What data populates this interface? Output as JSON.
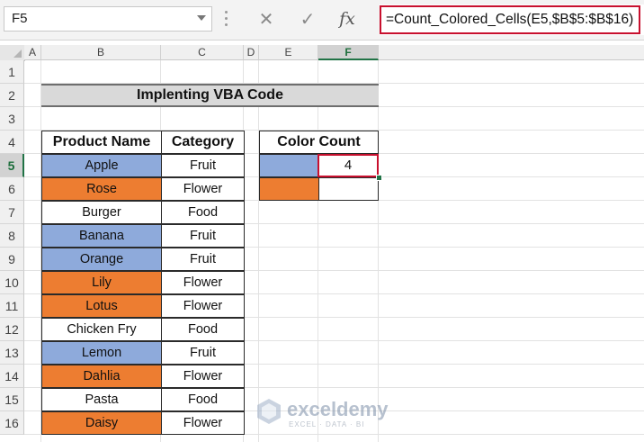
{
  "formula_bar": {
    "name_box": "F5",
    "cancel_icon": "✕",
    "enter_icon": "✓",
    "fx_label": "fx",
    "formula": "=Count_Colored_Cells(E5,$B$5:$B$16)"
  },
  "columns": [
    "A",
    "B",
    "C",
    "D",
    "E",
    "F"
  ],
  "rows": [
    "1",
    "2",
    "3",
    "4",
    "5",
    "6",
    "7",
    "8",
    "9",
    "10",
    "11",
    "12",
    "13",
    "14",
    "15",
    "16"
  ],
  "title": "Implenting VBA Code",
  "product_table": {
    "headers": [
      "Product Name",
      "Category"
    ],
    "rows": [
      {
        "name": "Apple",
        "category": "Fruit",
        "color": "blue"
      },
      {
        "name": "Rose",
        "category": "Flower",
        "color": "orange"
      },
      {
        "name": "Burger",
        "category": "Food",
        "color": "none"
      },
      {
        "name": "Banana",
        "category": "Fruit",
        "color": "blue"
      },
      {
        "name": "Orange",
        "category": "Fruit",
        "color": "blue"
      },
      {
        "name": "Lily",
        "category": "Flower",
        "color": "orange"
      },
      {
        "name": "Lotus",
        "category": "Flower",
        "color": "orange"
      },
      {
        "name": "Chicken Fry",
        "category": "Food",
        "color": "none"
      },
      {
        "name": "Lemon",
        "category": "Fruit",
        "color": "blue"
      },
      {
        "name": "Dahlia",
        "category": "Flower",
        "color": "orange"
      },
      {
        "name": "Pasta",
        "category": "Food",
        "color": "none"
      },
      {
        "name": "Daisy",
        "category": "Flower",
        "color": "orange"
      }
    ]
  },
  "color_count_table": {
    "header": "Color Count",
    "rows": [
      {
        "color": "blue",
        "count": "4"
      },
      {
        "color": "orange",
        "count": ""
      }
    ]
  },
  "colors": {
    "blue": "#8eaadb",
    "orange": "#ed7d31",
    "active_border": "#c8102e",
    "excel_green": "#217346"
  },
  "watermark": {
    "brand": "exceldemy",
    "tagline": "EXCEL · DATA · BI"
  }
}
